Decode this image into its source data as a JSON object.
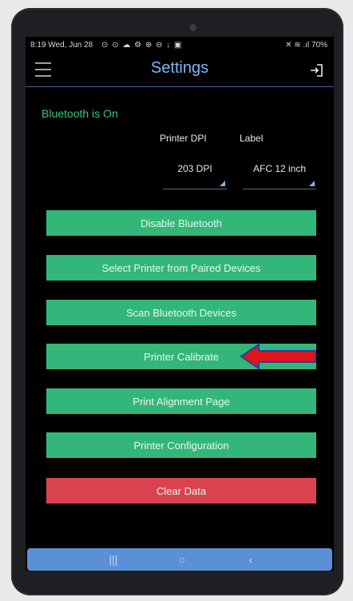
{
  "status": {
    "time": "8:19",
    "date": "Wed, Jun 28",
    "icons": "⊙ ⊙ ☁ ⚙ ⊕ ⊖ ↓ ▣",
    "battery": "70%",
    "connectivity": "✕ ≋ .ıl"
  },
  "appbar": {
    "title": "Settings"
  },
  "bluetooth_status": "Bluetooth is On",
  "printer_dpi": {
    "header": "Printer DPI",
    "value": "203 DPI"
  },
  "label": {
    "header": "Label",
    "value": "AFC 12 inch"
  },
  "buttons": {
    "disable_bluetooth": "Disable Bluetooth",
    "select_printer": "Select Printer from Paired Devices",
    "scan_devices": "Scan Bluetooth Devices",
    "printer_calibrate": "Printer Calibrate",
    "print_alignment": "Print Alignment Page",
    "printer_configuration": "Printer Configuration",
    "clear_data": "Clear Data"
  },
  "nav": {
    "recents": "|||",
    "home": "○",
    "back": "‹"
  },
  "colors": {
    "accent": "#7fb4f0",
    "status_green": "#38c77b",
    "button_green": "#33b679",
    "button_red": "#d9434f",
    "nav_blue": "#5b8fd6",
    "annotation_arrow": "#e0141c"
  }
}
